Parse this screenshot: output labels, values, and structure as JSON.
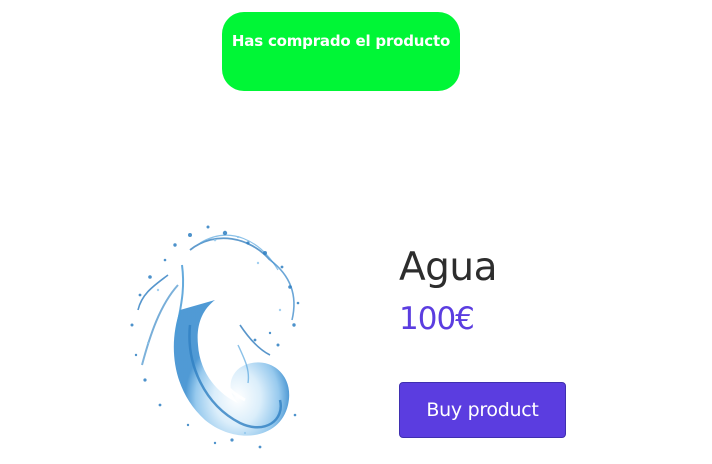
{
  "notification": {
    "message": "Has comprado el producto",
    "color": "#00f636"
  },
  "product": {
    "image_name": "water-splash-image",
    "name": "Agua",
    "price": "100€",
    "price_color": "#5b3de0",
    "buy_label": "Buy product",
    "button_color": "#5b3de0"
  }
}
